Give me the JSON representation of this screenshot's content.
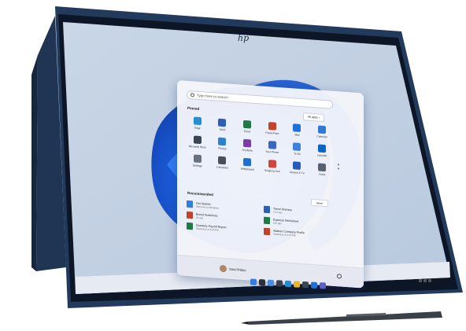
{
  "device": {
    "brand_mark": "hp"
  },
  "start_menu": {
    "search": {
      "placeholder": "Type here to search"
    },
    "pinned": {
      "title": "Pinned",
      "all_apps_label": "All apps",
      "apps": [
        {
          "label": "Edge",
          "color": "#1f8fd6",
          "icon": "edge-icon"
        },
        {
          "label": "Word",
          "color": "#2b5fb8",
          "icon": "word-icon"
        },
        {
          "label": "Excel",
          "color": "#1e7b45",
          "icon": "excel-icon"
        },
        {
          "label": "PowerPoint",
          "color": "#c4412a",
          "icon": "powerpoint-icon"
        },
        {
          "label": "Mail",
          "color": "#1c72d8",
          "icon": "mail-icon"
        },
        {
          "label": "Calendar",
          "color": "#2f78d6",
          "icon": "calendar-icon"
        },
        {
          "label": "Microsoft Store",
          "color": "#3a4556",
          "icon": "store-icon"
        },
        {
          "label": "Photos",
          "color": "#2d80d0",
          "icon": "photos-icon"
        },
        {
          "label": "OneNote",
          "color": "#7a3ca8",
          "icon": "onenote-icon"
        },
        {
          "label": "Your Phone",
          "color": "#3b64c4",
          "icon": "phone-icon"
        },
        {
          "label": "To Do",
          "color": "#3d7ee0",
          "icon": "todo-icon"
        },
        {
          "label": "LinkedIn",
          "color": "#0a66c2",
          "icon": "linkedin-icon"
        },
        {
          "label": "Settings",
          "color": "#6a7280",
          "icon": "settings-icon"
        },
        {
          "label": "Calculator",
          "color": "#4a4f5a",
          "icon": "calculator-icon"
        },
        {
          "label": "Whiteboard",
          "color": "#1f6fd1",
          "icon": "whiteboard-icon"
        },
        {
          "label": "Snipping Tool",
          "color": "#d2453a",
          "icon": "snipping-icon"
        },
        {
          "label": "Movies & TV",
          "color": "#2a5bb8",
          "icon": "movies-icon"
        },
        {
          "label": "Clock",
          "color": "#56606e",
          "icon": "clock-icon"
        }
      ]
    },
    "recommended": {
      "title": "Recommended",
      "more_label": "More",
      "items": [
        {
          "name": "Get Started",
          "sub": "Welcome to Windows",
          "color": "#2f7ee0"
        },
        {
          "name": "Travel Itinerary",
          "sub": "17m ago",
          "color": "#2b5fb8"
        },
        {
          "name": "Brand Guidelines",
          "sub": "2h ago",
          "color": "#c4412a"
        },
        {
          "name": "Expense Worksheet",
          "sub": "12h ago",
          "color": "#1e7b45"
        },
        {
          "name": "Quarterly Payroll Report",
          "sub": "Yesterday at 4:24 PM",
          "color": "#1e7b45"
        },
        {
          "name": "Adatum Company Profile",
          "sub": "Yesterday at 1:15 PM",
          "color": "#c4412a"
        }
      ]
    },
    "user": {
      "name": "Sara Philips"
    }
  },
  "taskbar": {
    "icons": [
      {
        "name": "start",
        "color": "#2f7ee0"
      },
      {
        "name": "search",
        "color": "#2a2f3a"
      },
      {
        "name": "widgets",
        "color": "#4a90e2"
      },
      {
        "name": "task-view",
        "color": "#3a3f4a"
      },
      {
        "name": "edge",
        "color": "#1f8fd6"
      },
      {
        "name": "file-explorer",
        "color": "#e8b431"
      },
      {
        "name": "store",
        "color": "#3a4556"
      },
      {
        "name": "mail",
        "color": "#1c72d8"
      },
      {
        "name": "teams",
        "color": "#5b5fc7"
      }
    ],
    "clock": {
      "time": "10:00 AM",
      "date": "10/1/2021"
    }
  }
}
